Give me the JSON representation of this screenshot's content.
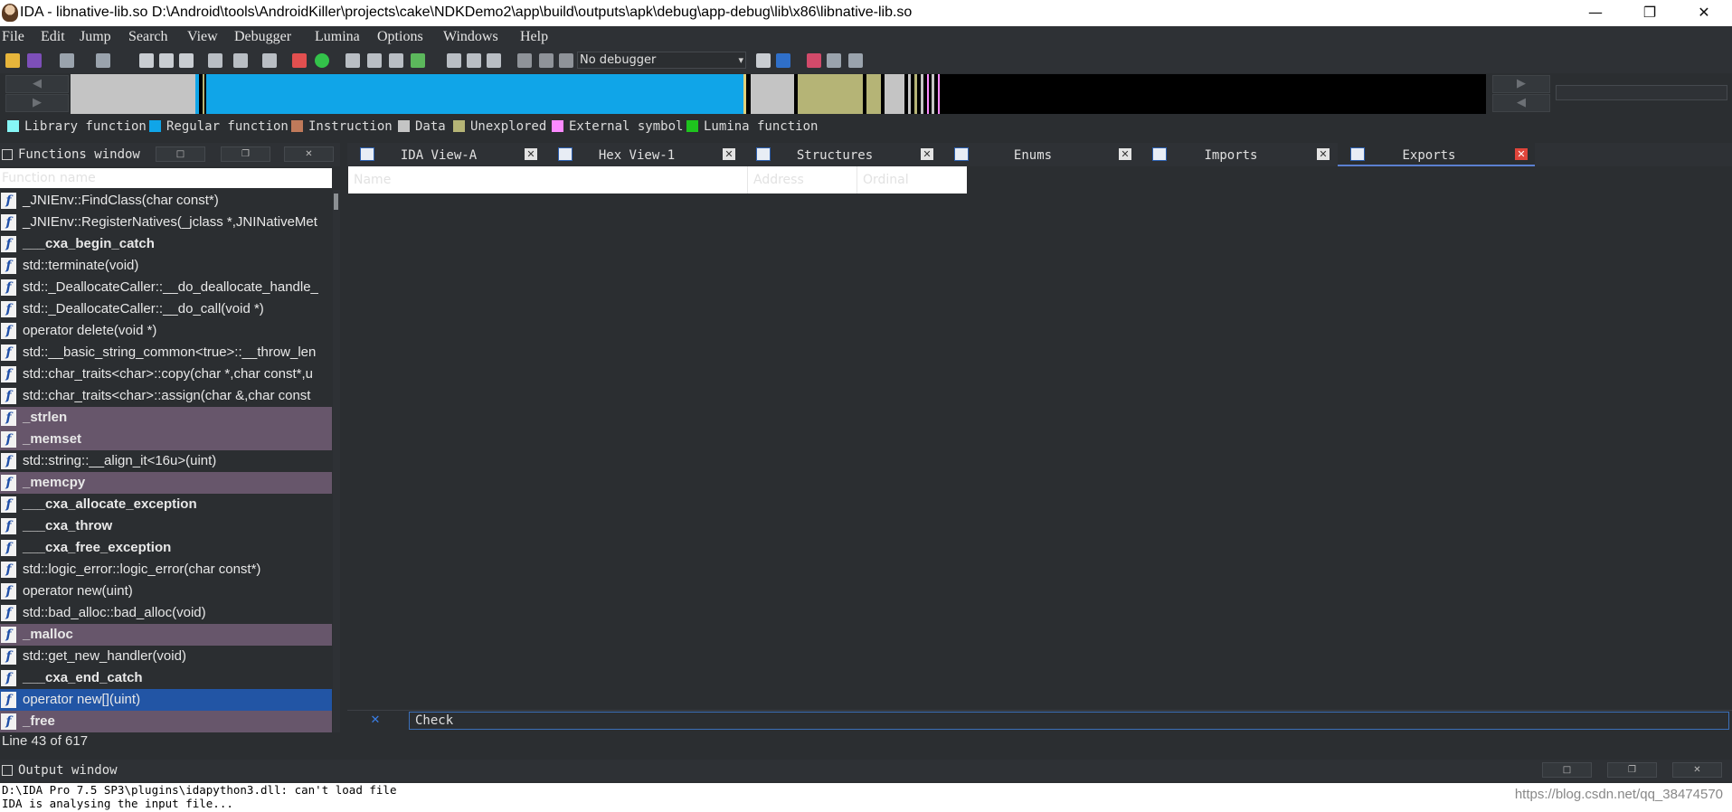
{
  "window": {
    "title": "IDA - libnative-lib.so D:\\Android\\tools\\AndroidKiller\\projects\\cake\\NDKDemo2\\app\\build\\outputs\\apk\\debug\\app-debug\\lib\\x86\\libnative-lib.so",
    "minimize": "—",
    "restore": "❐",
    "close": "✕"
  },
  "menu": [
    "File",
    "Edit",
    "Jump",
    "Search",
    "View",
    "Debugger",
    "Lumina",
    "Options",
    "Windows",
    "Help"
  ],
  "toolbar": {
    "debugger_select": "No debugger",
    "debugger_chevron": "▾"
  },
  "navband": {
    "left_up_arrow": "◀",
    "left_down_arrow": "▶",
    "right_up_arrow": "▶",
    "right_down_arrow": "◀"
  },
  "legend": [
    {
      "label": "Library function",
      "color": "#86f6f6"
    },
    {
      "label": "Regular function",
      "color": "#10a5e8"
    },
    {
      "label": "Instruction",
      "color": "#c07a5a"
    },
    {
      "label": "Data",
      "color": "#c4c4c4"
    },
    {
      "label": "Unexplored",
      "color": "#b5b476"
    },
    {
      "label": "External symbol",
      "color": "#fc8aff"
    },
    {
      "label": "Lumina function",
      "color": "#1ec41e"
    }
  ],
  "functions_window": {
    "title": "Functions window",
    "column_header": "Function name",
    "status": "Line 43 of 617",
    "btn_min": "□",
    "btn_float": "❐",
    "btn_close": "✕",
    "rows": [
      {
        "name": "_JNIEnv::FindClass(char const*)",
        "kind": "regular"
      },
      {
        "name": "_JNIEnv::RegisterNatives(_jclass *,JNINativeMet",
        "kind": "regular"
      },
      {
        "name": "___cxa_begin_catch",
        "kind": "bold"
      },
      {
        "name": "std::terminate(void)",
        "kind": "regular"
      },
      {
        "name": "std::_DeallocateCaller::__do_deallocate_handle_",
        "kind": "regular"
      },
      {
        "name": "std::_DeallocateCaller::__do_call(void *)",
        "kind": "regular"
      },
      {
        "name": "operator delete(void *)",
        "kind": "regular"
      },
      {
        "name": "std::__basic_string_common<true>::__throw_len",
        "kind": "regular"
      },
      {
        "name": "std::char_traits<char>::copy(char *,char const*,u",
        "kind": "regular"
      },
      {
        "name": "std::char_traits<char>::assign(char &,char const",
        "kind": "regular"
      },
      {
        "name": "_strlen",
        "kind": "lib"
      },
      {
        "name": "_memset",
        "kind": "lib"
      },
      {
        "name": "std::string::__align_it<16u>(uint)",
        "kind": "regular"
      },
      {
        "name": "_memcpy",
        "kind": "lib"
      },
      {
        "name": "___cxa_allocate_exception",
        "kind": "bold"
      },
      {
        "name": "___cxa_throw",
        "kind": "bold"
      },
      {
        "name": "___cxa_free_exception",
        "kind": "bold"
      },
      {
        "name": "std::logic_error::logic_error(char const*)",
        "kind": "regular"
      },
      {
        "name": "operator new(uint)",
        "kind": "regular"
      },
      {
        "name": "std::bad_alloc::bad_alloc(void)",
        "kind": "regular"
      },
      {
        "name": "_malloc",
        "kind": "lib"
      },
      {
        "name": "std::get_new_handler(void)",
        "kind": "regular"
      },
      {
        "name": "___cxa_end_catch",
        "kind": "bold"
      },
      {
        "name": "operator new[](uint)",
        "kind": "selected"
      },
      {
        "name": "_free",
        "kind": "lib"
      }
    ]
  },
  "tabs": [
    {
      "label": "IDA View-A",
      "close": "✕"
    },
    {
      "label": "Hex View-1",
      "close": "✕"
    },
    {
      "label": "Structures",
      "close": "✕"
    },
    {
      "label": "Enums",
      "close": "✕"
    },
    {
      "label": "Imports",
      "close": "✕"
    },
    {
      "label": "Exports",
      "close": "✕",
      "active": true
    }
  ],
  "exports": {
    "columns": [
      "Name",
      "Address",
      "Ordinal"
    ]
  },
  "checkbar": {
    "close": "✕",
    "text": "Check"
  },
  "output": {
    "title": "Output window",
    "btn_min": "□",
    "btn_float": "❐",
    "btn_close": "✕",
    "lines": [
      "D:\\IDA Pro 7.5 SP3\\plugins\\idapython3.dll: can't load file",
      "IDA is analysing the input file..."
    ],
    "watermark": "https://blog.csdn.net/qq_38474570"
  },
  "colors": {
    "library_row": "#67566b",
    "selected_row": "#2255a5",
    "active_tab_close": "#e0453b"
  }
}
